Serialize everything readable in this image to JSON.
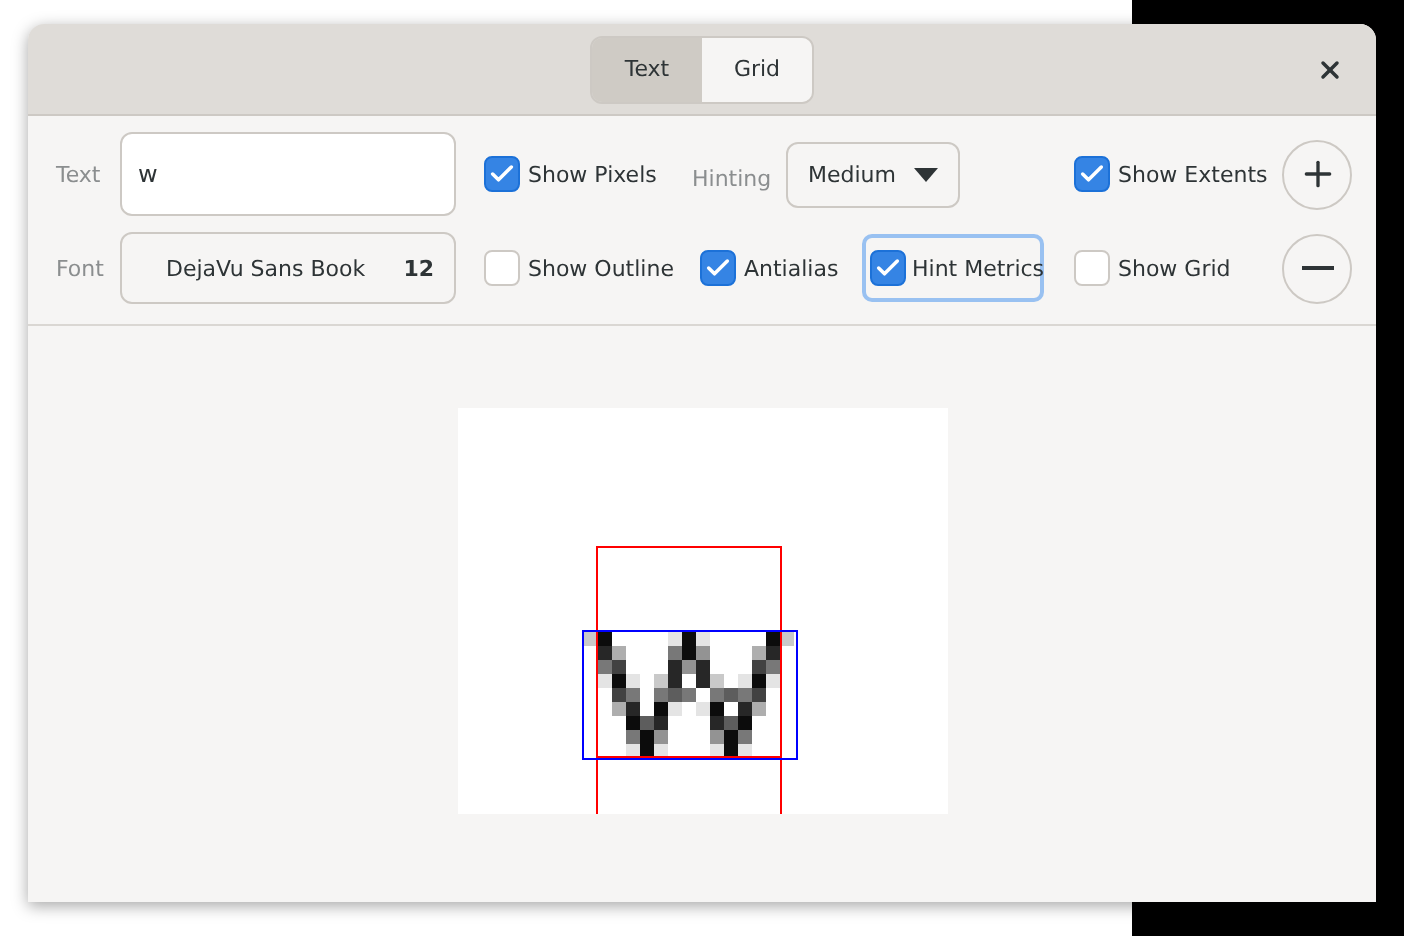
{
  "tabs": [
    {
      "label": "Text",
      "selected": true
    },
    {
      "label": "Grid",
      "selected": false
    }
  ],
  "text_label": "Text",
  "text_value": "w",
  "font_label": "Font",
  "font_name": "DejaVu Sans Book",
  "font_size": "12",
  "hinting_label": "Hinting",
  "hinting_value": "Medium",
  "options": [
    {
      "label": "Show Pixels",
      "checked": true,
      "kind": "check"
    },
    {
      "label": "Show Extents",
      "checked": true,
      "kind": "check"
    },
    {
      "label": "Show Outline",
      "checked": false,
      "kind": "check"
    },
    {
      "label": "Antialias",
      "checked": true,
      "kind": "check"
    },
    {
      "label": "Hint Metrics",
      "checked": true,
      "kind": "toggle"
    },
    {
      "label": "Show Grid",
      "checked": false,
      "kind": "check"
    }
  ]
}
